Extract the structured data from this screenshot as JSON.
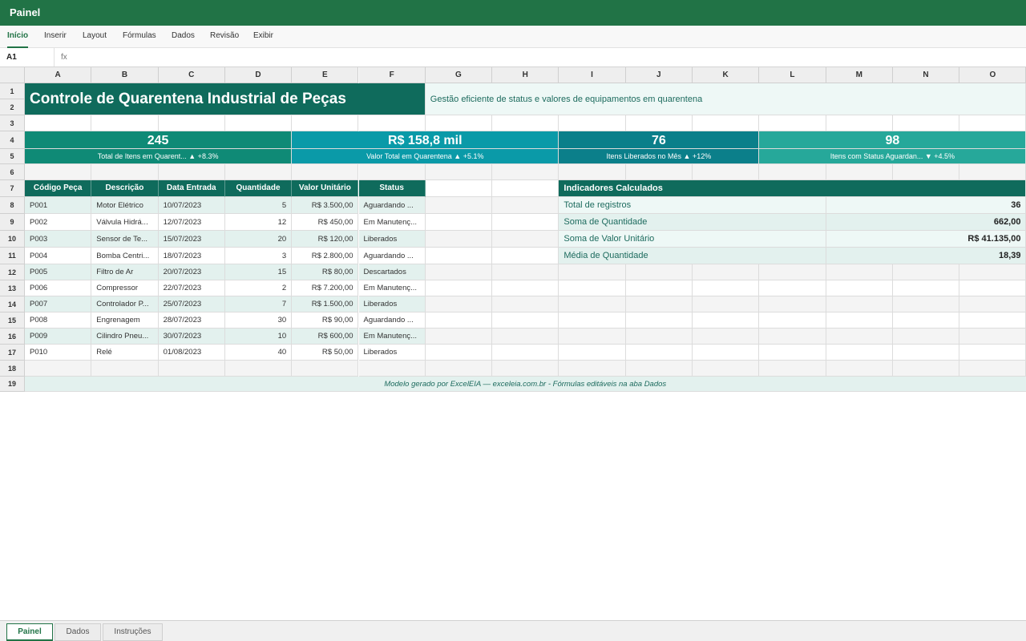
{
  "window": {
    "title": "Painel"
  },
  "ribbon": {
    "tabs": [
      "Início",
      "Inserir",
      "Layout",
      "Fórmulas",
      "Dados",
      "Revisão",
      "Exibir"
    ],
    "active": "Início"
  },
  "formula_bar": {
    "cell_ref": "A1",
    "fx_label": "fx",
    "value": ""
  },
  "columns": [
    "A",
    "B",
    "C",
    "D",
    "E",
    "F",
    "G",
    "H",
    "I",
    "J",
    "K",
    "L",
    "M",
    "N",
    "O"
  ],
  "rows": [
    "1",
    "2",
    "3",
    "4",
    "5",
    "6",
    "7",
    "8",
    "9",
    "10",
    "11",
    "12",
    "13",
    "14",
    "15",
    "16",
    "17",
    "18",
    "19"
  ],
  "header": {
    "title": "Controle de Quarentena Industrial de Peças",
    "subtitle": "Gestão eficiente de status e valores de equipamentos em quarentena"
  },
  "kpis": [
    {
      "value": "245",
      "label": "Total de Itens em Quarent... ▲ +8.3%",
      "color": "#0f8a76"
    },
    {
      "value": "R$ 158,8 mil",
      "label": "Valor Total em Quarentena ▲ +5.1%",
      "color": "#0a9aa8"
    },
    {
      "value": "76",
      "label": "Itens Liberados no Mês ▲ +12%",
      "color": "#0b7f8a"
    },
    {
      "value": "98",
      "label": "Itens com Status Aguardan... ▼ +4.5%",
      "color": "#26a89a"
    }
  ],
  "table": {
    "headers": [
      "Código Peça",
      "Descrição",
      "Data Entrada",
      "Quantidade",
      "Valor Unitário",
      "Status"
    ],
    "rows": [
      [
        "P001",
        "Motor Elétrico",
        "10/07/2023",
        "5",
        "R$ 3.500,00",
        "Aguardando ..."
      ],
      [
        "P002",
        "Válvula Hidrá...",
        "12/07/2023",
        "12",
        "R$ 450,00",
        "Em Manutenç..."
      ],
      [
        "P003",
        "Sensor de Te...",
        "15/07/2023",
        "20",
        "R$ 120,00",
        "Liberados"
      ],
      [
        "P004",
        "Bomba Centri...",
        "18/07/2023",
        "3",
        "R$ 2.800,00",
        "Aguardando ..."
      ],
      [
        "P005",
        "Filtro de Ar",
        "20/07/2023",
        "15",
        "R$ 80,00",
        "Descartados"
      ],
      [
        "P006",
        "Compressor",
        "22/07/2023",
        "2",
        "R$ 7.200,00",
        "Em Manutenç..."
      ],
      [
        "P007",
        "Controlador P...",
        "25/07/2023",
        "7",
        "R$ 1.500,00",
        "Liberados"
      ],
      [
        "P008",
        "Engrenagem",
        "28/07/2023",
        "30",
        "R$ 90,00",
        "Aguardando ..."
      ],
      [
        "P009",
        "Cilindro Pneu...",
        "30/07/2023",
        "10",
        "R$ 600,00",
        "Em Manutenç..."
      ],
      [
        "P010",
        "Relé",
        "01/08/2023",
        "40",
        "R$ 50,00",
        "Liberados"
      ]
    ]
  },
  "indicators": {
    "title": "Indicadores Calculados",
    "items": [
      {
        "label": "Total de registros",
        "value": "36"
      },
      {
        "label": "Soma de Quantidade",
        "value": "662,00"
      },
      {
        "label": "Soma de Valor Unitário",
        "value": "R$ 41.135,00"
      },
      {
        "label": "Média de Quantidade",
        "value": "18,39"
      }
    ]
  },
  "footer": {
    "text": "Modelo gerado por ExcelEIA — exceleia.com.br - Fórmulas editáveis na aba Dados"
  },
  "sheet_tabs": [
    "Painel",
    "Dados",
    "Instruções"
  ],
  "active_sheet": "Painel"
}
